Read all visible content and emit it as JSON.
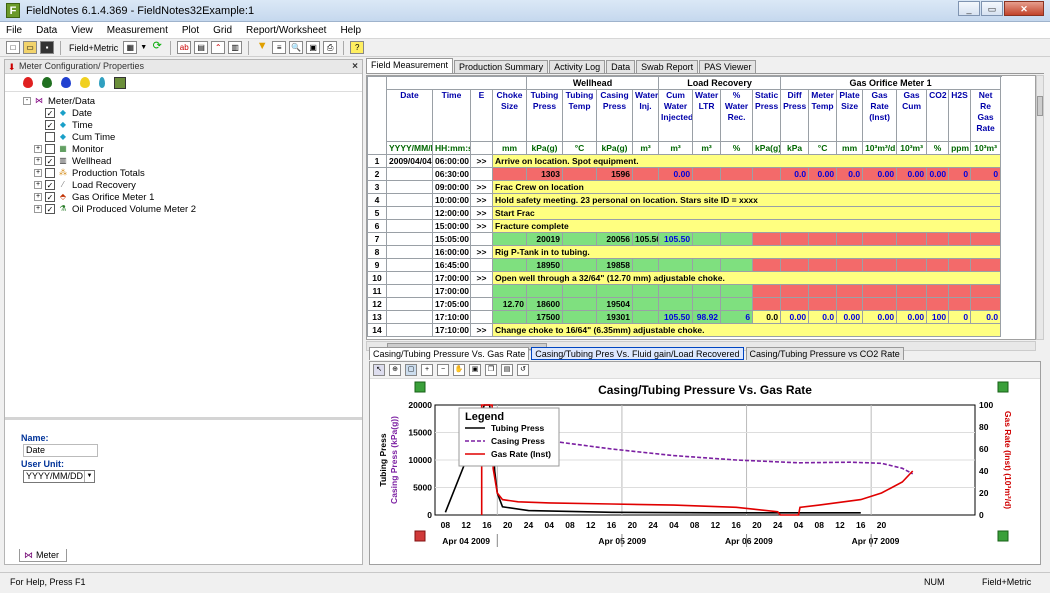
{
  "window": {
    "title": "FieldNotes 6.1.4.369 - FieldNotes32Example:1",
    "app_icon": "F"
  },
  "menu": [
    "File",
    "Data",
    "View",
    "Measurement",
    "Plot",
    "Grid",
    "Report/Worksheet",
    "Help"
  ],
  "toolbar": {
    "units_label": "Field+Metric"
  },
  "left": {
    "panel_title": "Meter Configuration/ Properties",
    "tree": [
      {
        "label": "Meter/Data",
        "level": 0,
        "exp": "-",
        "cb": "",
        "icon": "meter-data-icon"
      },
      {
        "label": "Date",
        "level": 1,
        "exp": "",
        "cb": "✓",
        "icon": "data-field-icon"
      },
      {
        "label": "Time",
        "level": 1,
        "exp": "",
        "cb": "✓",
        "icon": "data-field-icon"
      },
      {
        "label": "Cum Time",
        "level": 1,
        "exp": "",
        "cb": "",
        "icon": "data-field-icon"
      },
      {
        "label": "Monitor",
        "level": 1,
        "exp": "+",
        "cb": "",
        "icon": "monitor-icon"
      },
      {
        "label": "Wellhead",
        "level": 1,
        "exp": "+",
        "cb": "✓",
        "icon": "wellhead-icon"
      },
      {
        "label": "Production Totals",
        "level": 1,
        "exp": "+",
        "cb": "",
        "icon": "production-totals-icon"
      },
      {
        "label": "Load Recovery",
        "level": 1,
        "exp": "+",
        "cb": "✓",
        "icon": "load-recovery-icon"
      },
      {
        "label": "Gas Orifice Meter 1",
        "level": 1,
        "exp": "+",
        "cb": "✓",
        "icon": "gas-meter-icon"
      },
      {
        "label": "Oil Produced Volume Meter 2",
        "level": 1,
        "exp": "+",
        "cb": "✓",
        "icon": "oil-meter-icon"
      }
    ],
    "props": {
      "name_label": "Name:",
      "name_value": "Date",
      "unit_label": "User Unit:",
      "unit_value": "YYYY/MM/DD"
    },
    "bottom_tab": "Meter"
  },
  "tabs": [
    "Field Measurement",
    "Production Summary",
    "Activity Log",
    "Data",
    "Swab Report",
    "PAS Viewer"
  ],
  "grid": {
    "groups": [
      {
        "label": "",
        "span": 4
      },
      {
        "label": "Wellhead",
        "span": 4
      },
      {
        "label": "Load Recovery",
        "span": 4
      },
      {
        "label": "Gas Orifice Meter 1",
        "span": 9
      }
    ],
    "columns": [
      "Date",
      "Time",
      "E",
      "Choke Size",
      "Tubing Press",
      "Tubing Temp",
      "Casing Press",
      "Water Inj.",
      "Cum Water Injected",
      "Water LTR",
      "% Water Rec.",
      "Static Press",
      "Diff Press",
      "Meter Temp",
      "Plate Size",
      "Gas Rate (Inst)",
      "Gas Cum",
      "CO2",
      "H2S",
      "Net Re Gas Rate"
    ],
    "units": [
      "YYYY/MM/DD",
      "HH:mm:ss",
      "",
      "mm",
      "kPa(g)",
      "°C",
      "kPa(g)",
      "m³",
      "m³",
      "m³",
      "%",
      "kPa(g)",
      "kPa",
      "°C",
      "mm",
      "10³m³/d",
      "10³m³",
      "%",
      "ppm",
      "10³m³"
    ],
    "rows": [
      {
        "n": "1",
        "date": "2009/04/04",
        "time": "06:00:00",
        "msg": "Arrive on location.  Spot equipment."
      },
      {
        "n": "2",
        "time": "06:30:00",
        "cells": [
          "",
          "1303",
          "",
          "1596",
          "",
          "0.00",
          "",
          "",
          "",
          "0.0",
          "0.00",
          "0.0",
          "0.00",
          "0.00",
          "0.00",
          "0",
          "0",
          "0.0"
        ],
        "cls": [
          "r",
          "r",
          "r",
          "r",
          "r",
          "r",
          "r",
          "r",
          "r",
          "r",
          "r",
          "r",
          "r",
          "r",
          "r",
          "r",
          "r",
          "r"
        ]
      },
      {
        "n": "3",
        "time": "09:00:00",
        "msg": "Frac Crew on location"
      },
      {
        "n": "4",
        "time": "10:00:00",
        "msg": "Hold safety meeting.  23 personal on location.  Stars site ID = xxxx"
      },
      {
        "n": "5",
        "time": "12:00:00",
        "msg": "Start Frac"
      },
      {
        "n": "6",
        "time": "15:00:00",
        "msg": "Fracture complete"
      },
      {
        "n": "7",
        "time": "15:05:00",
        "cells": [
          "",
          "20019",
          "",
          "20056",
          "105.50",
          "105.50",
          "",
          "",
          "",
          "",
          "",
          "",
          "",
          "",
          "",
          "",
          "",
          ""
        ],
        "cls": [
          "g",
          "g",
          "g",
          "g",
          "g",
          "g",
          "g",
          "g",
          "r",
          "r",
          "r",
          "r",
          "r",
          "r",
          "r",
          "r",
          "r",
          "r"
        ]
      },
      {
        "n": "8",
        "time": "16:00:00",
        "msg": "Rig P-Tank in to tubing."
      },
      {
        "n": "9",
        "time": "16:45:00",
        "cells": [
          "",
          "18950",
          "",
          "19858",
          "",
          "",
          "",
          "",
          "",
          "",
          "",
          "",
          "",
          "",
          "",
          "",
          "",
          ""
        ],
        "cls": [
          "g",
          "g",
          "g",
          "g",
          "g",
          "g",
          "g",
          "g",
          "r",
          "r",
          "r",
          "r",
          "r",
          "r",
          "r",
          "r",
          "r",
          "r"
        ]
      },
      {
        "n": "10",
        "time": "17:00:00",
        "msg": "Open well through a 32/64\" (12.70 mm) adjustable choke."
      },
      {
        "n": "11",
        "time": "17:00:00",
        "cells": [
          "",
          "",
          "",
          "",
          "",
          "",
          "",
          "",
          "",
          "",
          "",
          "",
          "",
          "",
          "",
          "",
          "",
          ""
        ],
        "cls": [
          "g",
          "g",
          "g",
          "g",
          "g",
          "g",
          "g",
          "g",
          "r",
          "r",
          "r",
          "r",
          "r",
          "r",
          "r",
          "r",
          "r",
          "r"
        ]
      },
      {
        "n": "12",
        "time": "17:05:00",
        "cells": [
          "12.70",
          "18600",
          "",
          "19504",
          "",
          "",
          "",
          "",
          "",
          "",
          "",
          "",
          "",
          "",
          "",
          "",
          "",
          ""
        ],
        "cls": [
          "g",
          "g",
          "g",
          "g",
          "g",
          "g",
          "g",
          "g",
          "r",
          "r",
          "r",
          "r",
          "r",
          "r",
          "r",
          "r",
          "r",
          "r"
        ]
      },
      {
        "n": "13",
        "time": "17:10:00",
        "cells": [
          "",
          "17500",
          "",
          "19301",
          "",
          "105.50",
          "98.92",
          "6",
          "0.0",
          "0.00",
          "0.0",
          "0.00",
          "0.00",
          "0.00",
          "100",
          "0",
          "0.0",
          ""
        ],
        "cls": [
          "g",
          "g",
          "g",
          "g",
          "g",
          "g",
          "g",
          "g",
          "y",
          "y",
          "y",
          "y",
          "y",
          "y",
          "y",
          "y",
          "y",
          "y"
        ]
      },
      {
        "n": "14",
        "time": "17:10:00",
        "msg": "Change choke to 16/64\" (6.35mm) adjustable choke."
      }
    ],
    "arrow": ">>"
  },
  "chart_tabs": [
    "Casing/Tubing Pressure Vs. Gas Rate",
    "Casing/Tubing Pres Vs. Fluid gain/Load Recovered",
    "Casing/Tubing Pressure vs CO2 Rate"
  ],
  "chart_data": {
    "type": "line",
    "title": "Casing/Tubing Pressure Vs. Gas Rate",
    "ylabel_left": [
      "Tubing Press",
      "Casing Press (kPa(g))"
    ],
    "ylabel_right": "Gas Rate (Inst) (10³m³/d)",
    "ylim_left": [
      0,
      20000
    ],
    "ylim_right": [
      0,
      100
    ],
    "left_ticks": [
      "0",
      "5000",
      "10000",
      "15000",
      "20000"
    ],
    "right_ticks": [
      "0",
      "20",
      "40",
      "60",
      "80",
      "100"
    ],
    "x_hours": [
      "08",
      "12",
      "16",
      "20",
      "24",
      "04",
      "08",
      "12",
      "16",
      "20",
      "24",
      "04",
      "08",
      "12",
      "16",
      "20",
      "24",
      "04",
      "08",
      "12",
      "16",
      "20"
    ],
    "x_dates": [
      "Apr 04 2009",
      "Apr 05 2009",
      "Apr 06 2009",
      "Apr 07 2009"
    ],
    "legend_title": "Legend",
    "series": [
      {
        "name": "Tubing Press",
        "color": "#000000",
        "axis": "left",
        "dash": "",
        "points": [
          [
            8,
            500
          ],
          [
            12,
            10000
          ],
          [
            15.5,
            20000
          ],
          [
            16.5,
            20000
          ],
          [
            17,
            17500
          ],
          [
            17.5,
            8000
          ],
          [
            18,
            4000
          ],
          [
            19,
            1500
          ],
          [
            24,
            800
          ],
          [
            40,
            500
          ],
          [
            60,
            400
          ],
          [
            88,
            400
          ]
        ]
      },
      {
        "name": "Casing Press",
        "color": "#7b1fa2",
        "axis": "left",
        "dash": "4 2",
        "points": [
          [
            17,
            19301
          ],
          [
            18,
            17800
          ],
          [
            22,
            15500
          ],
          [
            28,
            13500
          ],
          [
            40,
            12000
          ],
          [
            52,
            10800
          ],
          [
            64,
            10000
          ],
          [
            76,
            9500
          ],
          [
            86,
            9600
          ],
          [
            92,
            9400
          ],
          [
            96,
            8500
          ],
          [
            98,
            7500
          ]
        ]
      },
      {
        "name": "Gas Rate (Inst)",
        "color": "#e00000",
        "axis": "right",
        "dash": "",
        "points": [
          [
            15,
            0
          ],
          [
            15,
            100
          ],
          [
            17,
            100
          ],
          [
            17.2,
            42
          ],
          [
            18,
            20
          ],
          [
            19,
            14
          ],
          [
            22,
            12
          ],
          [
            28,
            11
          ],
          [
            40,
            10
          ],
          [
            52,
            9
          ],
          [
            64,
            7
          ],
          [
            72,
            3
          ],
          [
            72.5,
            0
          ],
          [
            76,
            0
          ],
          [
            76.3,
            7
          ],
          [
            80,
            9
          ],
          [
            88,
            14
          ],
          [
            92,
            20
          ],
          [
            96,
            30
          ],
          [
            98,
            40
          ]
        ]
      }
    ]
  },
  "status": {
    "help": "For Help, Press F1",
    "num": "NUM",
    "units": "Field+Metric"
  }
}
